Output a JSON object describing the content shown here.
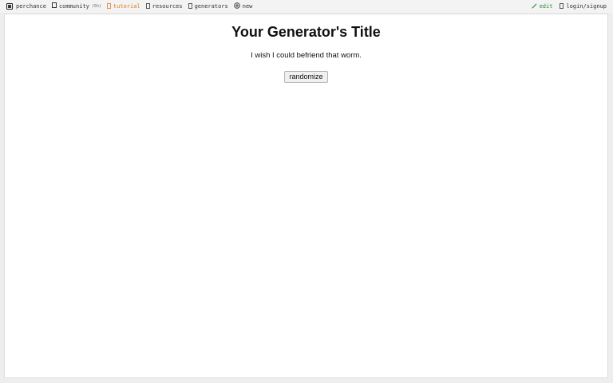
{
  "nav": {
    "site_label": "perchance",
    "community_label": "community",
    "community_count": "(5h)",
    "tutorial_label": "tutorial",
    "resources_label": "resources",
    "generators_label": "generators",
    "new_label": "new",
    "edit_label": "edit",
    "login_label": "login/signup",
    "icons": {
      "site": "die-icon",
      "community": "chat-icon",
      "tutorial": "book-icon",
      "resources": "box-icon",
      "generators": "gear-icon",
      "new": "plus-circle-icon",
      "edit": "pencil-icon",
      "login": "user-icon"
    },
    "colors": {
      "tutorial": "#e07b1f",
      "edit": "#2e8b3a"
    }
  },
  "main": {
    "title": "Your Generator's Title",
    "output": "I wish I could befriend that worm.",
    "button_label": "randomize"
  }
}
